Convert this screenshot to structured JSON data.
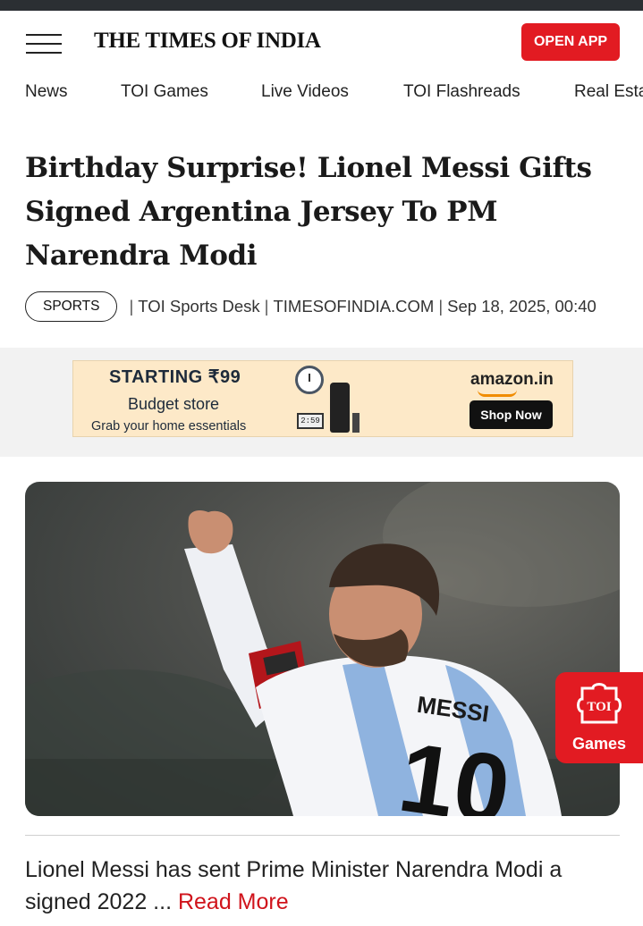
{
  "header": {
    "logo_text": "THE TIMES OF INDIA",
    "open_app_label": "OPEN APP",
    "accent_color": "#e21b22"
  },
  "nav": {
    "items": [
      "News",
      "TOI Games",
      "Live Videos",
      "TOI Flashreads",
      "Real Estate"
    ]
  },
  "article": {
    "headline": "Birthday Surprise! Lionel Messi Gifts Signed Argentina Jersey To PM Narendra Modi",
    "category": "SPORTS",
    "author": "TOI Sports Desk",
    "source": "TIMESOFINDIA.COM",
    "datetime": "Sep 18, 2025, 00:40",
    "summary": "Lionel Messi has sent Prime Minister Narendra Modi a signed 2022 ...",
    "read_more": "Read More"
  },
  "ad": {
    "headline": "STARTING ₹99",
    "subtitle": "Budget store",
    "tagline": "Grab your home essentials",
    "brand": "amazon.in",
    "cta": "Shop Now",
    "clock_display": "2:59"
  },
  "hero": {
    "jersey_name": "MESSI",
    "jersey_number": "10"
  },
  "games_widget": {
    "icon_text": "TOI",
    "label": "Games"
  },
  "icons": {
    "menu": "hamburger-menu-icon",
    "games": "puzzle-piece-icon"
  }
}
